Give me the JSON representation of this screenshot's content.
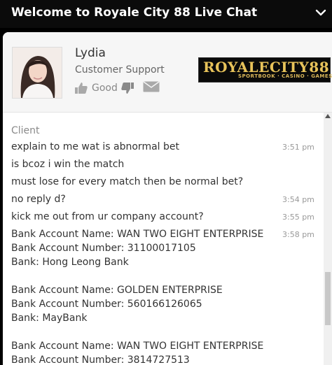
{
  "window": {
    "title": "Welcome to Royale City 88 Live Chat"
  },
  "agent": {
    "name": "Lydia",
    "role": "Customer Support",
    "rating_label": "Good"
  },
  "logo": {
    "main": "ROYALECITY88",
    "sub": "SPORTBOOK · CASINO · GAMES"
  },
  "chat": {
    "sender": "Client",
    "lines": [
      {
        "text": "explain to me wat is abnormal bet",
        "time": "3:51 pm"
      },
      {
        "text": "is bcoz i win the match",
        "time": ""
      },
      {
        "text": "must lose for every match then be normal bet?",
        "time": ""
      },
      {
        "text": "no reply d?",
        "time": "3:54 pm"
      },
      {
        "text": "kick me out from ur company account?",
        "time": "3:55 pm"
      },
      {
        "text": "Bank Account Name: WAN TWO EIGHT ENTERPRISE",
        "time": "3:58 pm"
      },
      {
        "text": "Bank Account Number: 31100017105",
        "time": ""
      },
      {
        "text": "Bank: Hong Leong Bank",
        "time": ""
      },
      {
        "text": "Bank Account Name: GOLDEN ENTERPRISE",
        "time": ""
      },
      {
        "text": "Bank Account Number: 560166126065",
        "time": ""
      },
      {
        "text": "Bank: MayBank",
        "time": ""
      },
      {
        "text": "Bank Account Name: WAN TWO EIGHT ENTERPRISE",
        "time": ""
      },
      {
        "text": "Bank Account Number: 3814727513",
        "time": ""
      }
    ]
  },
  "icons": {
    "minimize": "chevron-down-icon",
    "like": "thumbs-up-icon",
    "dislike": "thumbs-down-icon",
    "email": "mail-icon"
  }
}
